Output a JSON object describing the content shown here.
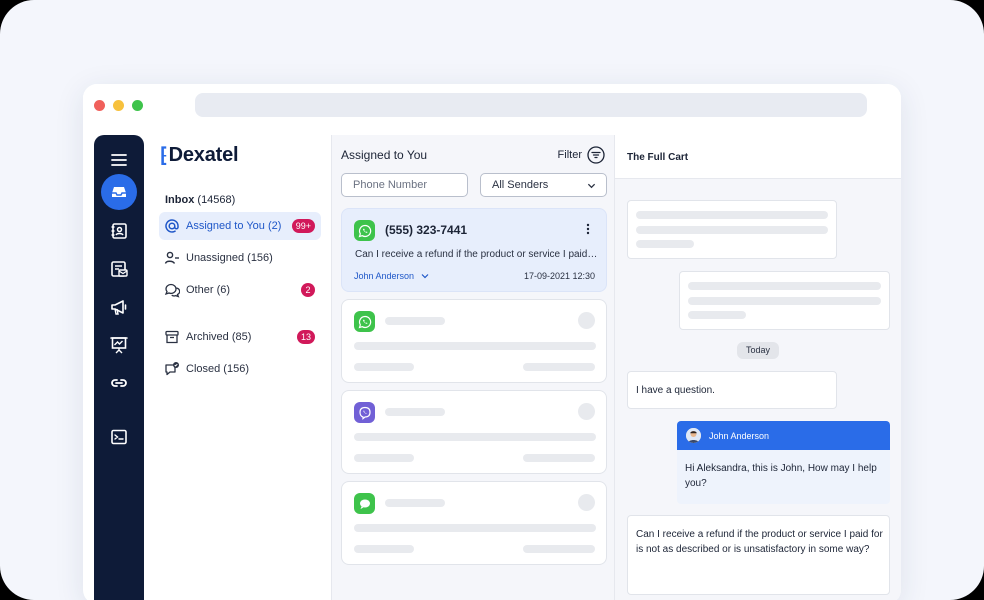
{
  "app": {
    "brand": "Dexatel"
  },
  "rail": {
    "icons": [
      "menu-icon",
      "inbox-icon",
      "contacts-icon",
      "templates-icon",
      "megaphone-icon",
      "presentation-icon",
      "link-icon",
      "terminal-icon"
    ],
    "active": "inbox-icon",
    "accent": "#2a6ce8",
    "background": "#0e1b38"
  },
  "nav": {
    "inbox_label": "Inbox",
    "inbox_count": "(14568)",
    "items": [
      {
        "label": "Assigned to You (2)",
        "badge": "99+",
        "icon": "at-icon",
        "active": true
      },
      {
        "label": "Unassigned (156)",
        "badge": "",
        "icon": "user-minus-icon",
        "active": false
      },
      {
        "label": "Other (6)",
        "badge": "2",
        "icon": "chat-bubbles-icon",
        "active": false
      },
      {
        "label": "Archived (85)",
        "badge": "13",
        "icon": "archive-icon",
        "active": false
      },
      {
        "label": "Closed (156)",
        "badge": "",
        "icon": "chat-check-icon",
        "active": false
      }
    ],
    "badge_color": "#d1195a"
  },
  "list": {
    "title": "Assigned to You",
    "filter_label": "Filter",
    "phone_placeholder": "Phone Number",
    "senders_value": "All Senders",
    "active_card": {
      "phone": "(555) 323-7441",
      "message": "Can I receive a refund if the product or service I paid for is not as described",
      "agent": "John Anderson",
      "time": "17-09-2021 12:30",
      "channel": "whatsapp-icon"
    },
    "other_cards": [
      "whatsapp-icon",
      "viber-icon",
      "imessage-icon"
    ]
  },
  "chat": {
    "title": "The Full Cart",
    "day_label": "Today",
    "customer_question": "I have a question.",
    "agent_name": "John Anderson",
    "agent_reply": "Hi Aleksandra, this is John, How may I help you?",
    "customer_refund": "Can I receive a refund if the product or service I paid for is not as described or is unsatisfactory in some way?"
  }
}
